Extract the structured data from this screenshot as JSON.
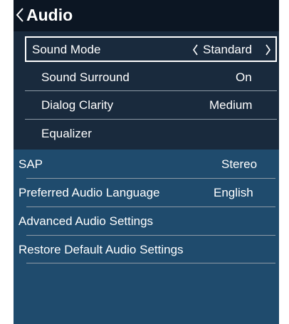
{
  "header": {
    "title": "Audio"
  },
  "menu": {
    "sound_mode": {
      "label": "Sound Mode",
      "value": "Standard"
    },
    "sound_surround": {
      "label": "Sound Surround",
      "value": "On"
    },
    "dialog_clarity": {
      "label": "Dialog Clarity",
      "value": "Medium"
    },
    "equalizer": {
      "label": "Equalizer"
    },
    "sap": {
      "label": "SAP",
      "value": "Stereo"
    },
    "preferred_language": {
      "label": "Preferred Audio Language",
      "value": "English"
    },
    "advanced": {
      "label": "Advanced Audio Settings"
    },
    "restore": {
      "label": "Restore Default Audio Settings"
    }
  }
}
